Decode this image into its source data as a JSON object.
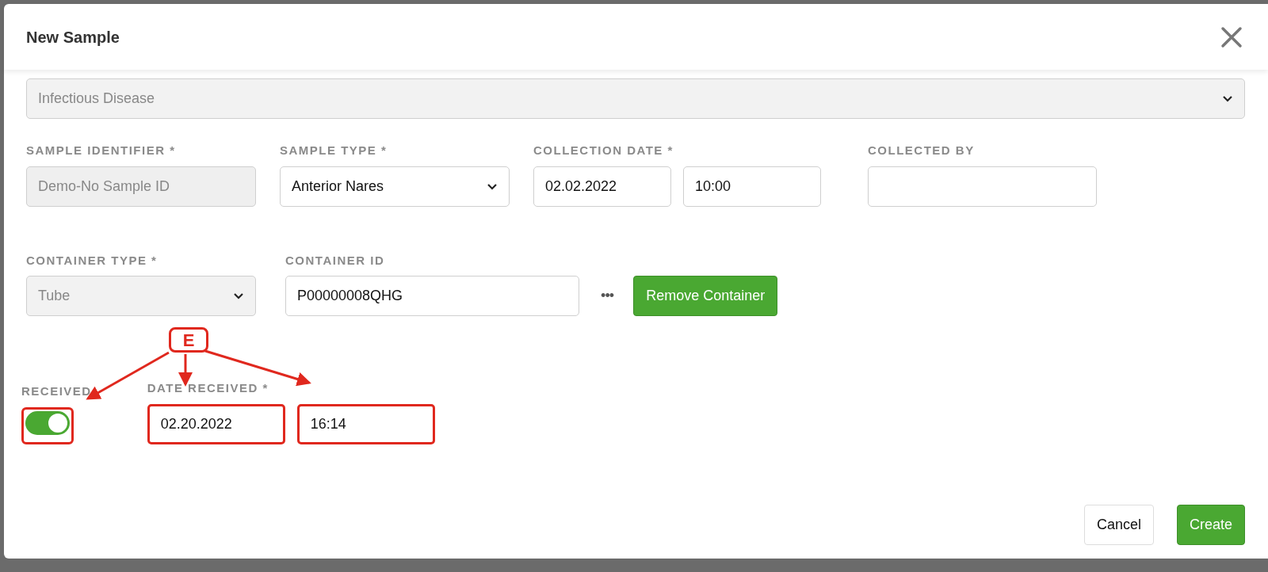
{
  "dialog": {
    "title": "New Sample"
  },
  "category_select": {
    "value": "Infectious Disease",
    "disabled": true
  },
  "sample_row": [
    {
      "kind": "text",
      "label": "SAMPLE IDENTIFIER *",
      "value": "Demo-No Sample ID",
      "disabled": true
    },
    {
      "kind": "select",
      "label": "SAMPLE TYPE *",
      "value": "Anterior Nares",
      "disabled": false
    },
    {
      "kind": "datetime",
      "label": "COLLECTION DATE *",
      "date": "02.02.2022",
      "time": "10:00",
      "highlighted": false
    },
    {
      "kind": "text",
      "label": "COLLECTED BY",
      "disabled": false
    }
  ],
  "container_row": [
    {
      "kind": "select",
      "label": "CONTAINER TYPE *",
      "value": "Tube",
      "disabled": true
    },
    {
      "kind": "text",
      "label": "CONTAINER ID",
      "value": "P00000008QHG",
      "disabled": false
    },
    {
      "kind": "more",
      "text": "•••"
    },
    {
      "kind": "button",
      "text": "Remove Container"
    }
  ],
  "received_row": [
    {
      "kind": "toggle",
      "label": "RECEIVED",
      "on": true,
      "highlighted": true
    },
    {
      "kind": "datetime",
      "label": "DATE RECEIVED *",
      "date": "02.20.2022",
      "time": "16:14",
      "highlighted": true
    }
  ],
  "annotation": {
    "label": "E"
  },
  "footer_buttons": [
    {
      "text": "Cancel",
      "kind": "secondary"
    },
    {
      "text": "Create",
      "kind": "primary"
    }
  ]
}
